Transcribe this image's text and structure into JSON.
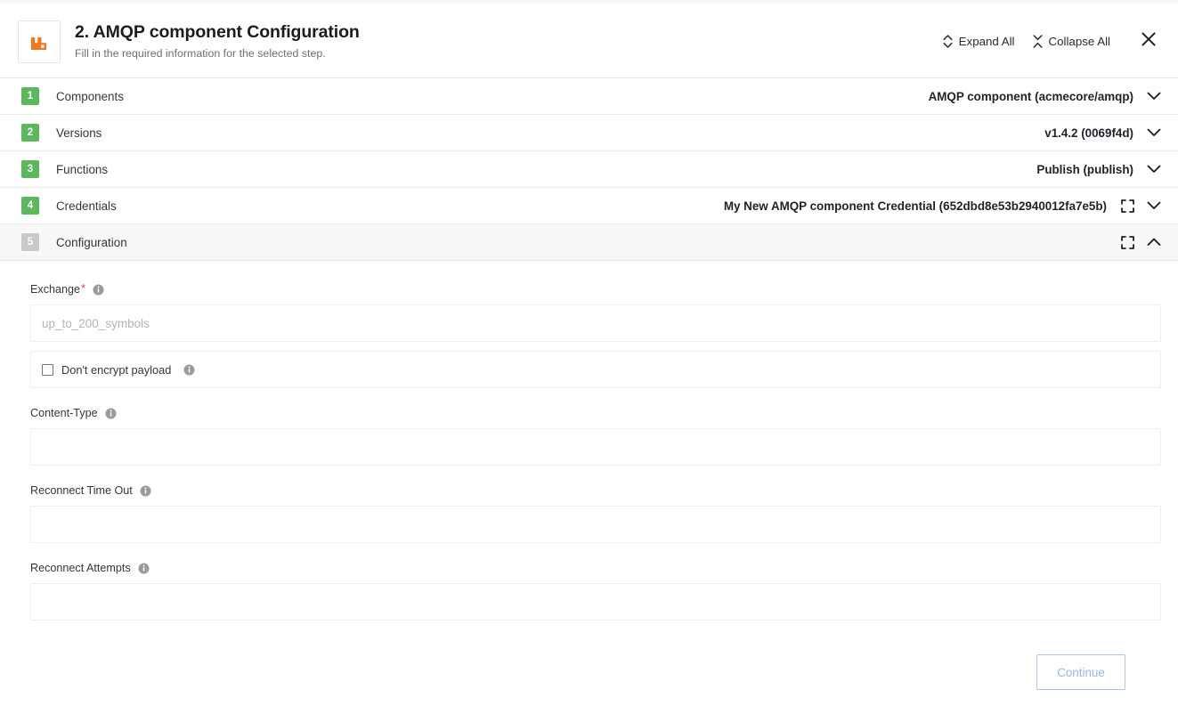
{
  "header": {
    "logo_icon": "rabbitmq-logo-icon",
    "title": "2. AMQP component Configuration",
    "subtitle": "Fill in the required information for the selected step.",
    "expand_all_label": "Expand All",
    "collapse_all_label": "Collapse All",
    "expand_all_icon": "expand-vertical-icon",
    "collapse_all_icon": "collapse-vertical-icon",
    "close_icon": "close-icon"
  },
  "accordion": {
    "rows": [
      {
        "number": "1",
        "label": "Components",
        "value": "AMQP component (acmecore/amqp)",
        "state": "collapsed",
        "badge_state": "complete",
        "has_fullscreen": false,
        "chevron_icon": "chevron-down-icon"
      },
      {
        "number": "2",
        "label": "Versions",
        "value": "v1.4.2 (0069f4d)",
        "state": "collapsed",
        "badge_state": "complete",
        "has_fullscreen": false,
        "chevron_icon": "chevron-down-icon"
      },
      {
        "number": "3",
        "label": "Functions",
        "value": "Publish (publish)",
        "state": "collapsed",
        "badge_state": "complete",
        "has_fullscreen": false,
        "chevron_icon": "chevron-down-icon"
      },
      {
        "number": "4",
        "label": "Credentials",
        "value": "My New AMQP component Credential (652dbd8e53b2940012fa7e5b)",
        "state": "collapsed",
        "badge_state": "complete",
        "has_fullscreen": true,
        "fullscreen_icon": "fullscreen-icon",
        "chevron_icon": "chevron-down-icon"
      },
      {
        "number": "5",
        "label": "Configuration",
        "value": "",
        "state": "expanded",
        "badge_state": "current",
        "has_fullscreen": true,
        "fullscreen_icon": "fullscreen-icon",
        "chevron_icon": "chevron-up-icon"
      }
    ]
  },
  "form": {
    "exchange": {
      "label": "Exchange",
      "required_marker": "*",
      "info_icon": "info-icon",
      "value": "",
      "placeholder": "up_to_200_symbols"
    },
    "dont_encrypt": {
      "label": "Don't encrypt payload",
      "checked": false,
      "info_icon": "info-icon"
    },
    "content_type": {
      "label": "Content-Type",
      "info_icon": "info-icon",
      "value": "",
      "placeholder": ""
    },
    "reconnect_timeout": {
      "label": "Reconnect Time Out",
      "info_icon": "info-icon",
      "value": "",
      "placeholder": ""
    },
    "reconnect_attempts": {
      "label": "Reconnect Attempts",
      "info_icon": "info-icon",
      "value": "",
      "placeholder": ""
    }
  },
  "footer": {
    "continue_label": "Continue"
  },
  "colors": {
    "badge_complete": "#5cb85c",
    "badge_current": "#c9c9c9",
    "logo_orange": "#f3761f",
    "required_star": "#e8425a",
    "continue_border": "#a9c4f5",
    "continue_text": "#9cb7ee"
  }
}
